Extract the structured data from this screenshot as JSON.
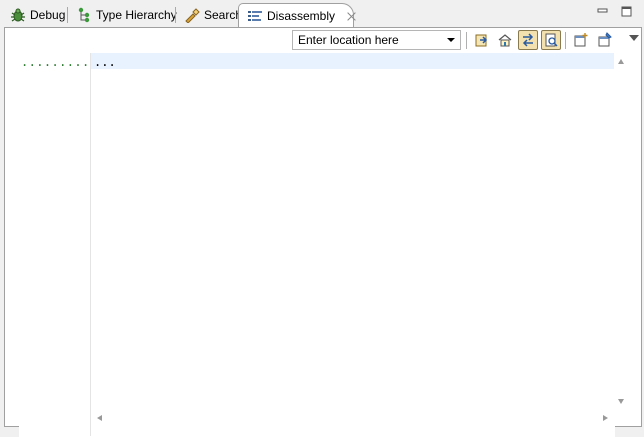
{
  "tabs": [
    {
      "label": "Debug",
      "icon": "bug-icon",
      "active": false
    },
    {
      "label": "Type Hierarchy",
      "icon": "type-hierarchy-icon",
      "active": false
    },
    {
      "label": "Search",
      "icon": "search-flashlight-icon",
      "active": false
    },
    {
      "label": "Disassembly",
      "icon": "disassembly-icon",
      "active": true
    }
  ],
  "toolbar": {
    "location_placeholder": "Enter location here",
    "buttons": [
      {
        "name": "go-to-address-icon",
        "on": false
      },
      {
        "name": "home-program-counter-icon",
        "on": false
      },
      {
        "name": "link-with-active-debug-context-icon",
        "on": true
      },
      {
        "name": "show-source-icon",
        "on": true
      },
      {
        "name": "open-new-view-icon",
        "on": false
      },
      {
        "name": "pin-view-icon",
        "on": false
      }
    ]
  },
  "editor": {
    "ruler_text": ".........",
    "code_line": "...",
    "current_line_color": "#e8f2fe",
    "ruler_text_color": "#2e7d32"
  },
  "colors": {
    "frame_bg": "#f0f0f0",
    "active_toggle": "#f3e1b0"
  }
}
